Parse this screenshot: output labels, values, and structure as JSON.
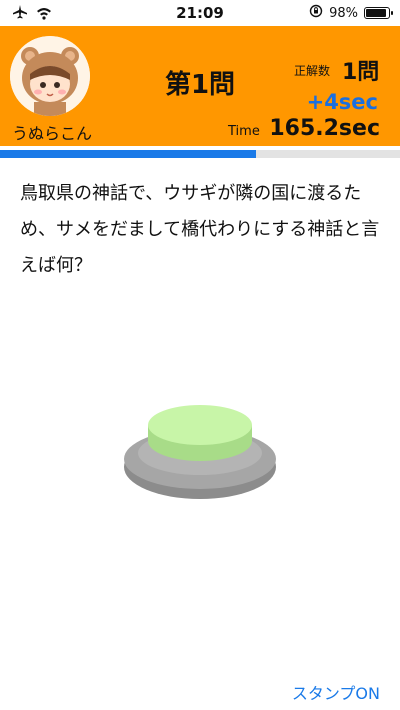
{
  "status": {
    "time": "21:09",
    "battery_percent": "98%",
    "battery_level": 0.98
  },
  "header": {
    "username": "うぬらこん",
    "quiz_number": "第1問",
    "correct_label": "正解数",
    "correct_value": "1問",
    "bonus": "+4sec",
    "time_label": "Time",
    "time_value": "165.2sec"
  },
  "progress": {
    "fraction": 0.64
  },
  "question": {
    "text": "鳥取県の神話で、ウサギが隣の国に渡るため、サメをだまして橋代わりにする神話と言えば何？"
  },
  "footer": {
    "stamp_label": "スタンプON"
  },
  "colors": {
    "header_bg": "#ff9700",
    "progress_fill": "#1a7ae8",
    "bonus_text": "#1a6fe0",
    "buzzer_top": "#c8f5a8"
  }
}
